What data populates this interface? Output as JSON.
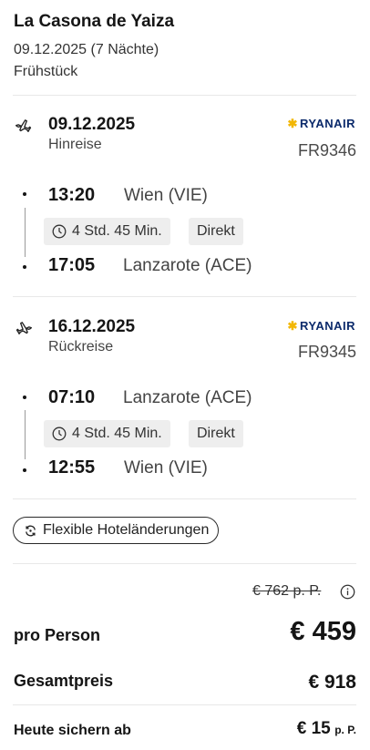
{
  "hotel": {
    "name": "La Casona de Yaiza",
    "dates": "09.12.2025 (7 Nächte)",
    "board": "Frühstück"
  },
  "outbound": {
    "date": "09.12.2025",
    "direction": "Hinreise",
    "airline": "RYANAIR",
    "flight_no": "FR9346",
    "dep_time": "13:20",
    "dep_place": "Wien (VIE)",
    "duration": "4 Std. 45 Min.",
    "stops": "Direkt",
    "arr_time": "17:05",
    "arr_place": "Lanzarote (ACE)"
  },
  "return": {
    "date": "16.12.2025",
    "direction": "Rückreise",
    "airline": "RYANAIR",
    "flight_no": "FR9345",
    "dep_time": "07:10",
    "dep_place": "Lanzarote (ACE)",
    "duration": "4 Std. 45 Min.",
    "stops": "Direkt",
    "arr_time": "12:55",
    "arr_place": "Wien (VIE)"
  },
  "flex_button": "Flexible Hoteländerungen",
  "pricing": {
    "old_price": "€ 762 p. P.",
    "per_person_label": "pro Person",
    "per_person_price": "€ 459",
    "total_label": "Gesamtpreis",
    "total_price": "€ 918",
    "secure_label": "Heute sichern ab",
    "secure_price": "€ 15",
    "secure_unit": "p. P."
  },
  "colors": {
    "airline_blue": "#0b2a6b",
    "airline_yellow": "#f2b705",
    "chip_bg": "#eeeeee"
  }
}
